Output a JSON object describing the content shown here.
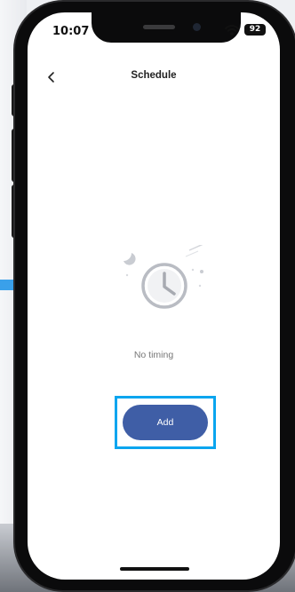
{
  "status_bar": {
    "time": "10:07",
    "battery": "92"
  },
  "header": {
    "title": "Schedule"
  },
  "empty_state": {
    "message": "No timing"
  },
  "actions": {
    "add_label": "Add"
  },
  "colors": {
    "accent_button": "#3f5ea6",
    "highlight_border": "#0aa5ef"
  }
}
